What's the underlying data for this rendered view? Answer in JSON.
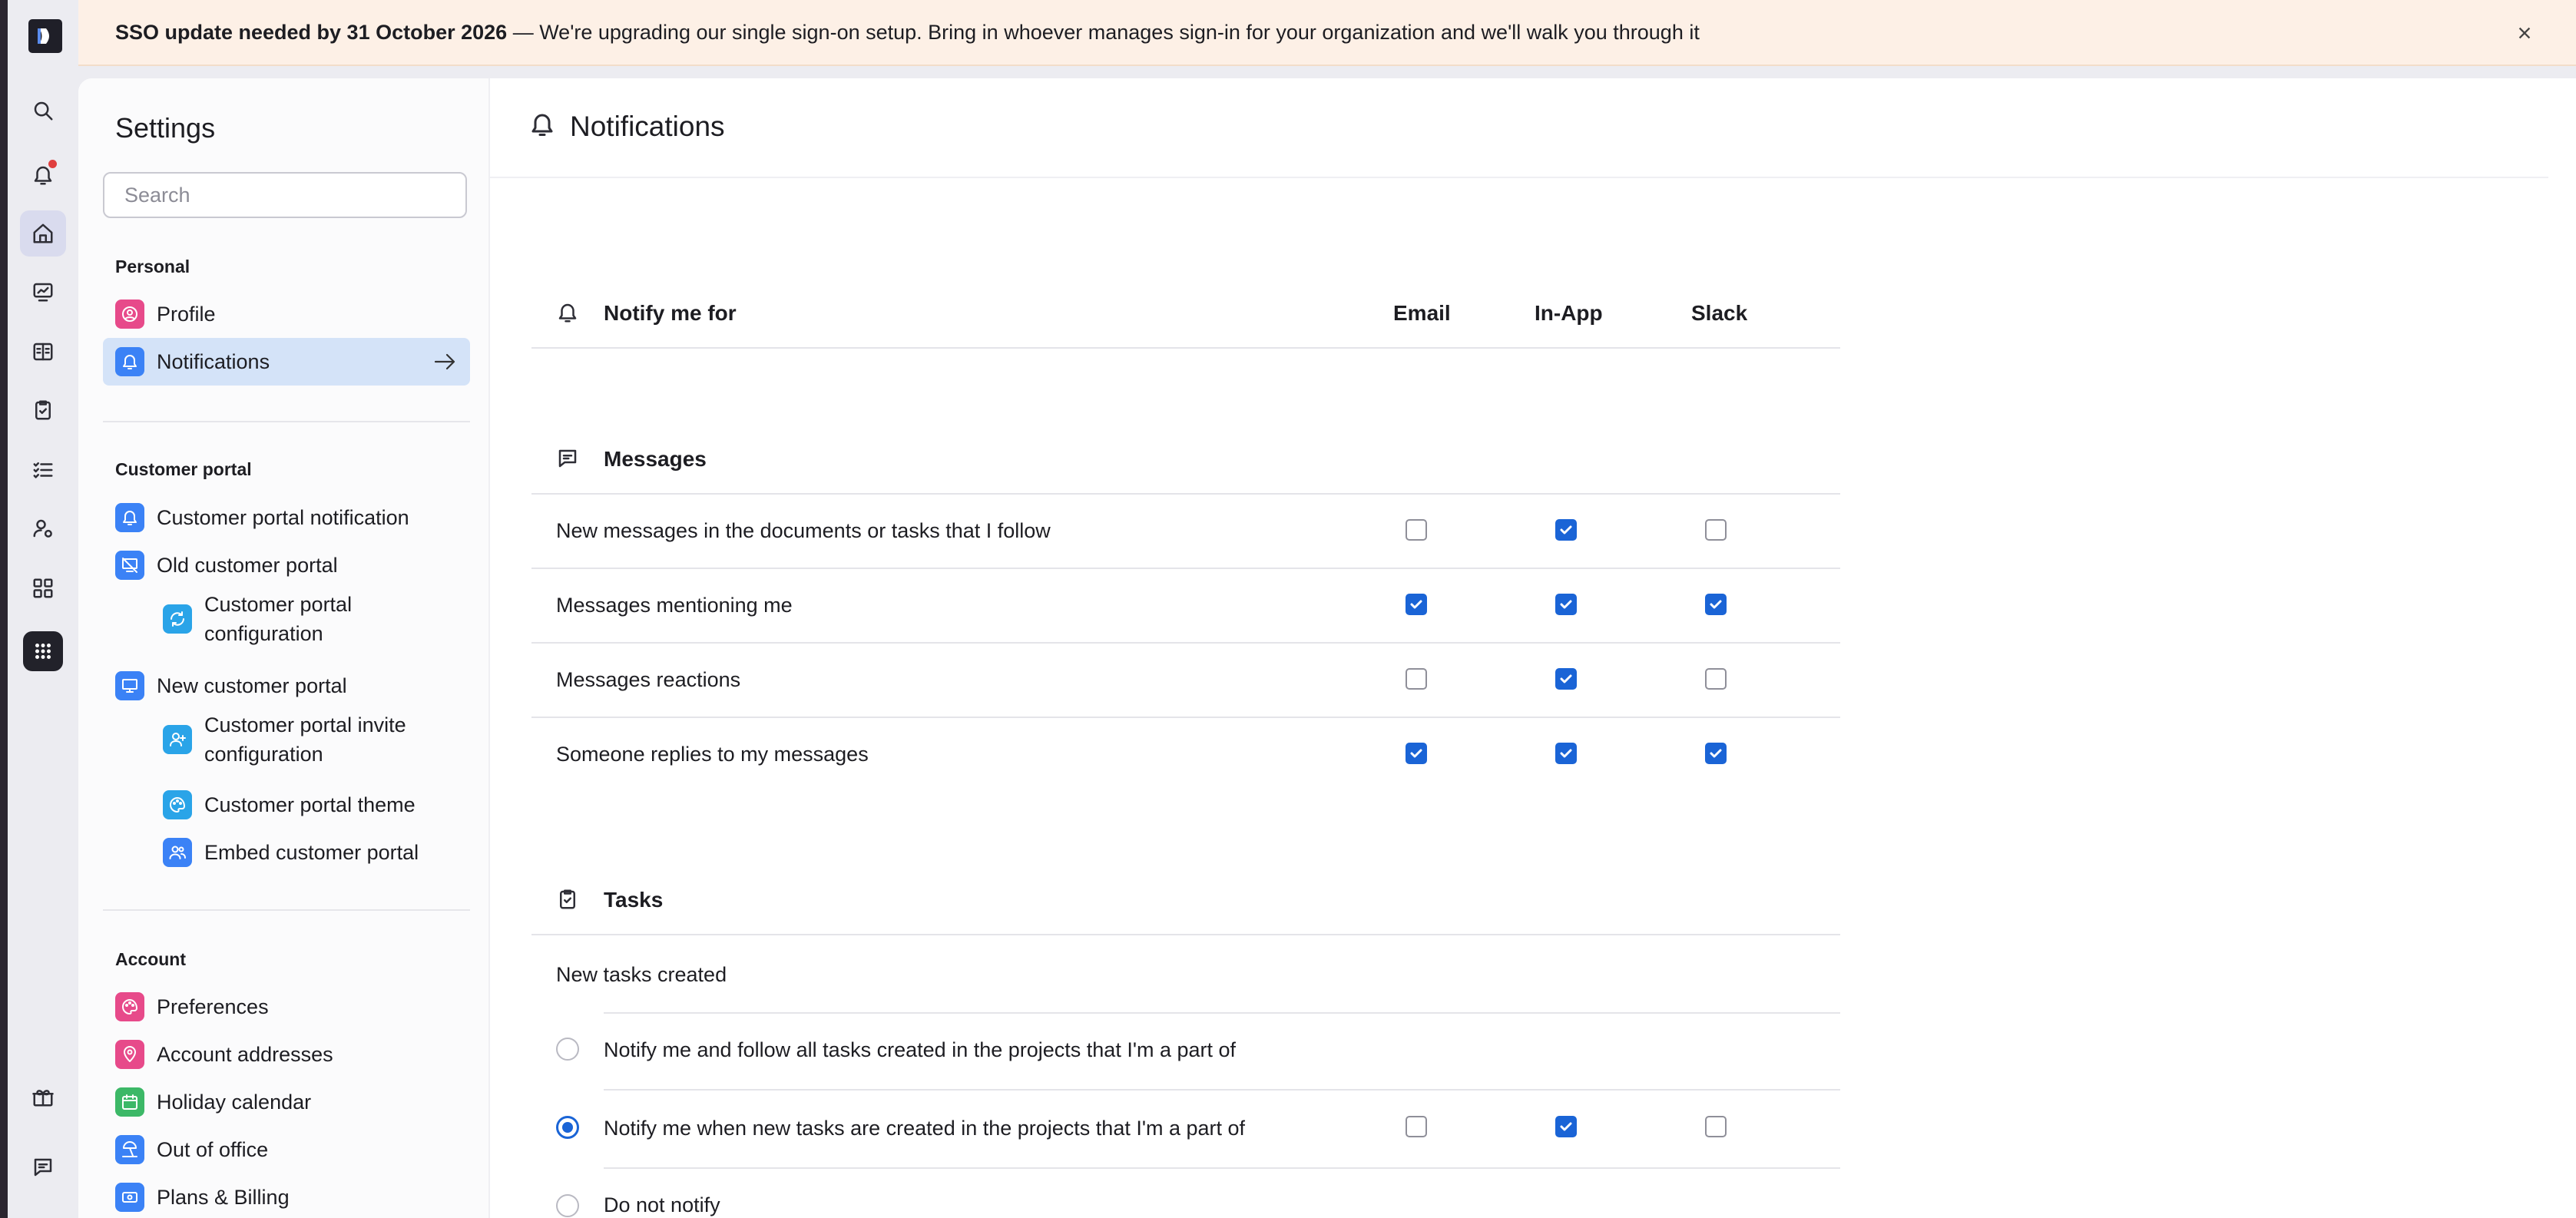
{
  "banner": {
    "bold": "SSO update needed by 31 October 2026",
    "text": " — We're upgrading our single sign-on setup. Bring in whoever manages sign-in for your organization and we'll walk you through it"
  },
  "rail": {
    "icons": [
      "search-icon",
      "bell-icon",
      "home-icon",
      "dashboard-icon",
      "documents-icon",
      "tasks-icon",
      "list-icon",
      "user-settings-icon",
      "widgets-icon",
      "apps-grid-icon",
      "gift-icon",
      "chat-icon"
    ],
    "active": "home-icon",
    "notification_dot_color": "#e03e3e"
  },
  "settings": {
    "title": "Settings",
    "search_placeholder": "Search",
    "personal_label": "Personal",
    "personal_items": [
      "Profile",
      "Notifications"
    ],
    "active_item": "Notifications",
    "customer_portal_label": "Customer portal",
    "customer_portal_items": [
      "Customer portal notification",
      "Old customer portal",
      "Customer portal configuration",
      "New customer portal",
      "Customer portal invite configuration",
      "Customer portal theme",
      "Embed customer portal"
    ],
    "account_label": "Account",
    "account_items": [
      "Preferences",
      "Account addresses",
      "Holiday calendar",
      "Out of office",
      "Plans & Billing"
    ]
  },
  "page": {
    "title": "Notifications",
    "notify_header": "Notify me for",
    "columns": [
      "Email",
      "In-App",
      "Slack"
    ],
    "messages_section": "Messages",
    "messages_rows": [
      {
        "label": "New messages in the documents or tasks that I follow",
        "email": false,
        "inapp": true,
        "slack": false
      },
      {
        "label": "Messages mentioning me",
        "email": true,
        "inapp": true,
        "slack": true
      },
      {
        "label": "Messages reactions",
        "email": false,
        "inapp": true,
        "slack": false
      },
      {
        "label": "Someone replies to my messages",
        "email": true,
        "inapp": true,
        "slack": true
      }
    ],
    "tasks_section": "Tasks",
    "tasks_new_label": "New tasks created",
    "tasks_options": [
      {
        "label": "Notify me and follow all tasks created in the projects that I'm a part of",
        "selected": false
      },
      {
        "label": "Notify me when new tasks are created in the projects that I'm a part of",
        "selected": true,
        "email": false,
        "inapp": true,
        "slack": false
      },
      {
        "label": "Do not notify",
        "selected": false
      }
    ]
  },
  "colors": {
    "accent": "#1a64d6",
    "active_nav": "#d4e3f8",
    "banner_bg": "#fdf0e6"
  }
}
